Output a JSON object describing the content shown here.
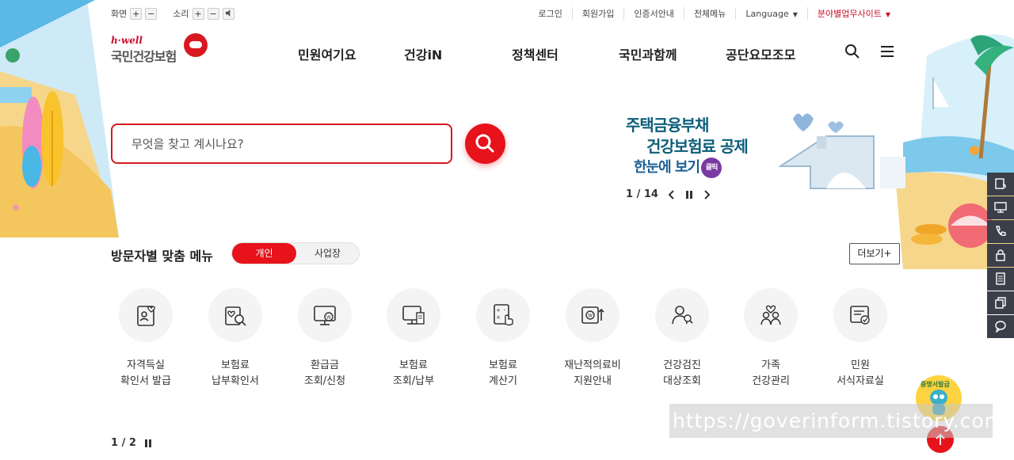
{
  "utility": {
    "screen_label": "화면",
    "sound_label": "소리",
    "plus": "+",
    "minus": "−",
    "links": [
      "로그인",
      "회원가입",
      "인증서안내",
      "전체메뉴"
    ],
    "language": "Language",
    "family_site": "분야별업무사이트"
  },
  "logo": {
    "top": "h·well",
    "main": "국민건강보험"
  },
  "gnb": [
    "민원여기요",
    "건강iN",
    "정책센터",
    "국민과함께",
    "공단요모조모"
  ],
  "search": {
    "placeholder": "무엇을 찾고 계시나요?"
  },
  "banner": {
    "line1": "주택금융부채",
    "line2": "건강보험료 공제",
    "line3": "한눈에 보기",
    "click": "클릭",
    "pager": "1 / 14"
  },
  "visitor": {
    "title": "방문자별 맞춤 메뉴",
    "tab_personal": "개인",
    "tab_business": "사업장",
    "more": "더보기+",
    "items": [
      {
        "l1": "자격득실",
        "l2": "확인서 발급",
        "icon": "id-card-heart-icon"
      },
      {
        "l1": "보험료",
        "l2": "납부확인서",
        "icon": "document-search-icon"
      },
      {
        "l1": "환급금",
        "l2": "조회/신청",
        "icon": "monitor-won-icon"
      },
      {
        "l1": "보험료",
        "l2": "조회/납부",
        "icon": "monitor-document-icon"
      },
      {
        "l1": "보험료",
        "l2": "계산기",
        "icon": "calculator-hand-icon"
      },
      {
        "l1": "재난적의료비",
        "l2": "지원안내",
        "icon": "won-card-icon"
      },
      {
        "l1": "건강검진",
        "l2": "대상조회",
        "icon": "people-search-icon"
      },
      {
        "l1": "가족",
        "l2": "건강관리",
        "icon": "family-heart-icon"
      },
      {
        "l1": "민원",
        "l2": "서식자료실",
        "icon": "document-check-icon"
      }
    ],
    "pager": "1 / 2"
  },
  "quickbar": [
    "certificate-icon",
    "monitor-user-icon",
    "phone-icon",
    "lock-icon",
    "document-icon",
    "copy-icon",
    "chat-icon"
  ],
  "mascot": {
    "text": "증명서발급"
  },
  "watermark": "https://goverinform.tistory.com",
  "colors": {
    "brand_red": "#e8121a",
    "banner_teal": "#0c5e7a",
    "quickbar": "#3a3f4a"
  }
}
